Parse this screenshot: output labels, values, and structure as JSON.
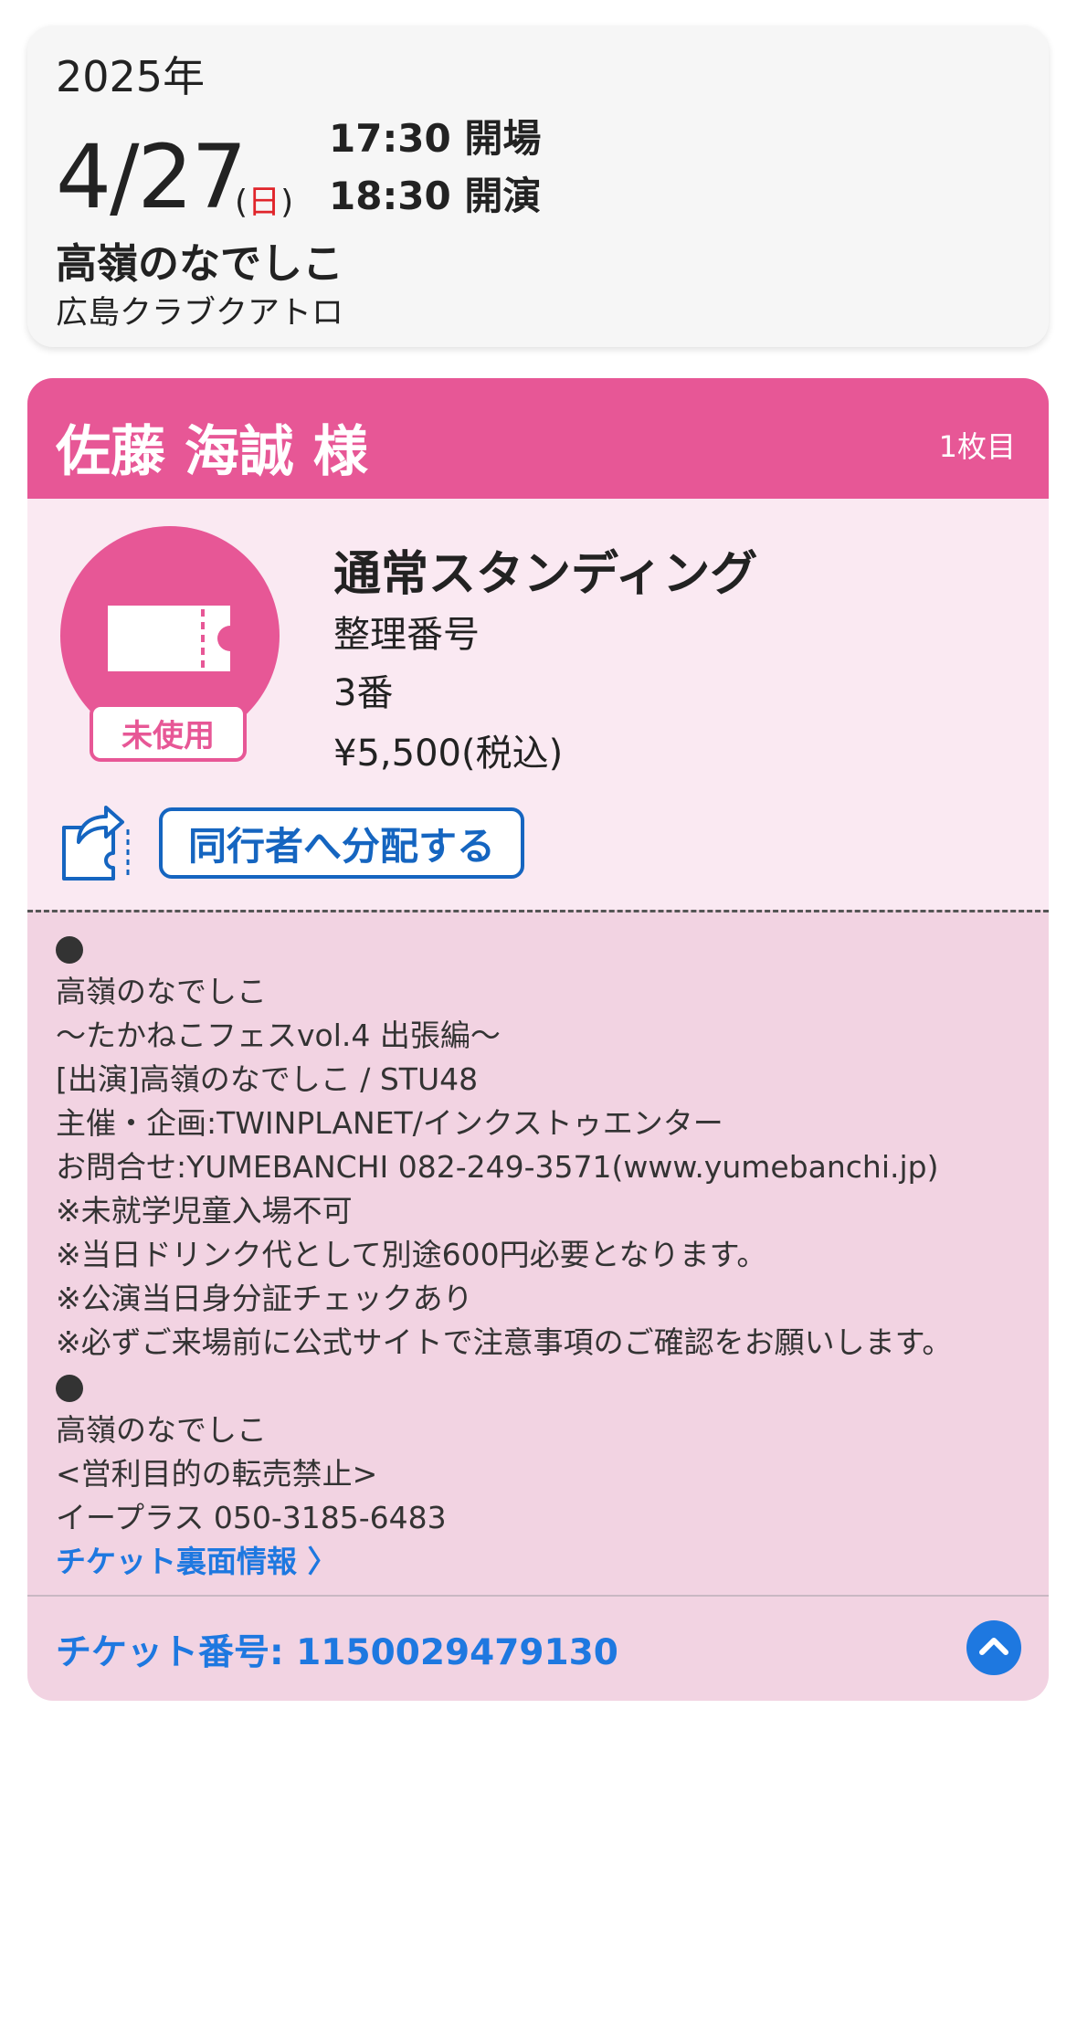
{
  "event": {
    "year": "2025年",
    "date": "4/27",
    "dow_open": "(",
    "dow_day": "日",
    "dow_close": ")",
    "open_time": "17:30 開場",
    "start_time": "18:30 開演",
    "artist": "高嶺のなでしこ",
    "venue": "広島クラブクアトロ"
  },
  "ticket": {
    "holder": "佐藤 海誠 様",
    "count": "1枚目",
    "status": "未使用",
    "seat_type": "通常スタンディング",
    "seat_label": "整理番号",
    "seat_number": "3番",
    "price": "¥5,500(税込)",
    "share_label": "同行者へ分配する",
    "info_lines": [
      "高嶺のなでしこ",
      "〜たかねこフェスvol.4 出張編〜",
      "[出演]高嶺のなでしこ / STU48",
      "主催・企画:TWINPLANET/インクストゥエンター",
      "お問合せ:YUMEBANCHI 082-249-3571(www.yumebanchi.jp)",
      "※未就学児童入場不可",
      "※当日ドリンク代として別途600円必要となります。",
      "※公演当日身分証チェックあり",
      "※必ずご来場前に公式サイトで注意事項のご確認をお願いします。"
    ],
    "info_lines_2": [
      "高嶺のなでしこ",
      "<営利目的の転売禁止>",
      "イープラス 050-3185-6483"
    ],
    "back_link": "チケット裏面情報 〉",
    "ticket_number": "チケット番号: 1150029479130"
  },
  "colors": {
    "accent_pink": "#e75796",
    "link_blue": "#1e78e0"
  },
  "icons": [
    "ticket-icon",
    "share-ticket-icon",
    "chevron-up-icon"
  ]
}
